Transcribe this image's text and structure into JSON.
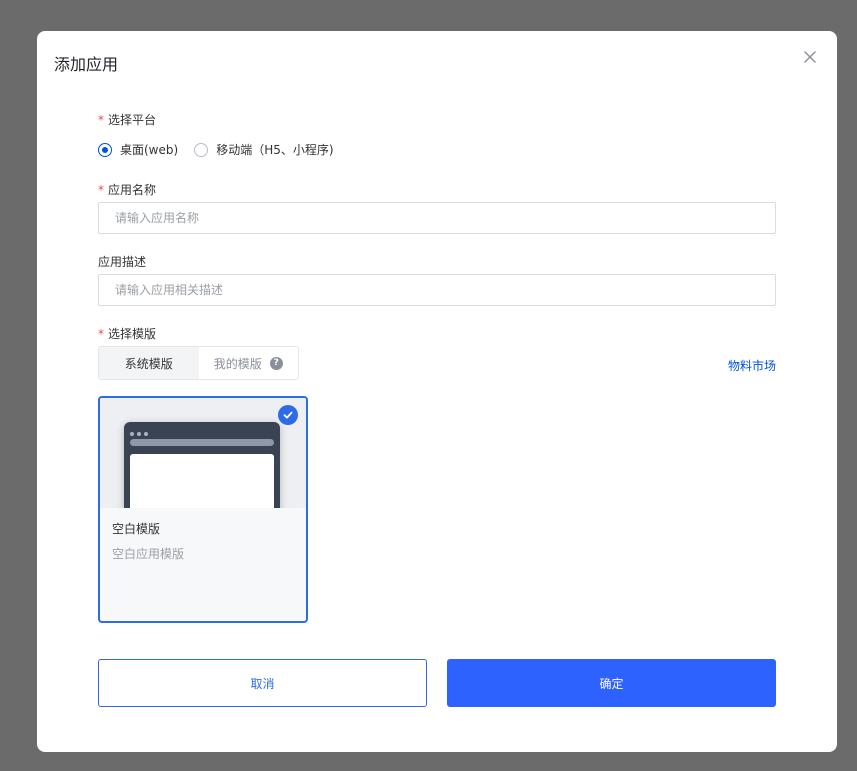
{
  "dialog": {
    "title": "添加应用",
    "close_icon": "close-icon"
  },
  "platform": {
    "label": "选择平台",
    "required_mark": "*",
    "options": [
      {
        "label": "桌面(web)",
        "checked": true
      },
      {
        "label": "移动端（H5、小程序)",
        "checked": false
      }
    ]
  },
  "app_name": {
    "label": "应用名称",
    "required_mark": "*",
    "value": "",
    "placeholder": "请输入应用名称"
  },
  "app_desc": {
    "label": "应用描述",
    "value": "",
    "placeholder": "请输入应用相关描述"
  },
  "template": {
    "label": "选择模版",
    "required_mark": "*",
    "tabs": [
      {
        "label": "系统模版",
        "active": true
      },
      {
        "label": "我的模版",
        "active": false,
        "help_icon": "question-circle-icon"
      }
    ],
    "market_link": "物料市场",
    "cards": [
      {
        "title": "空白模版",
        "desc": "空白应用模版",
        "selected": true
      }
    ]
  },
  "footer": {
    "cancel_label": "取消",
    "confirm_label": "确定"
  },
  "colors": {
    "accent": "#2e62ff",
    "required": "#e34d59",
    "link": "#0052d9"
  }
}
